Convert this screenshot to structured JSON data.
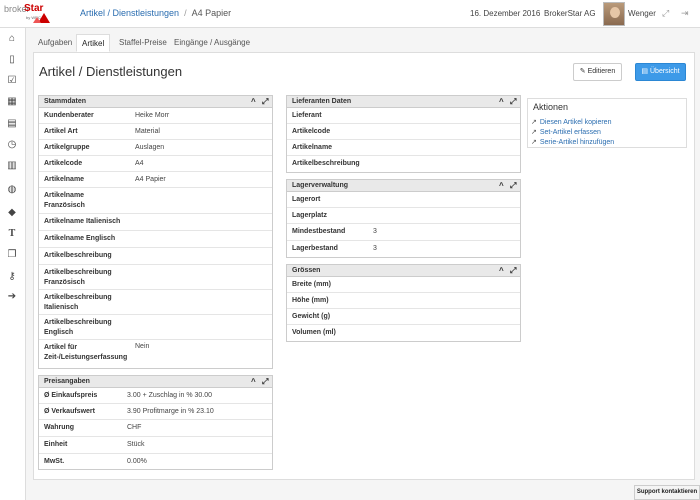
{
  "header": {
    "logo_text": "brokerStar",
    "logo_sub": "by WRC",
    "breadcrumb_parent": "Artikel / Dienstleistungen",
    "breadcrumb_sep": "/",
    "breadcrumb_current": "A4 Papier",
    "date": "16. Dezember 2016",
    "company": "BrokerStar AG",
    "username": "Wenger"
  },
  "sidebar": {
    "icons": [
      "home-icon",
      "document-icon",
      "checkbox-icon",
      "calendar-icon",
      "contract-icon",
      "clock-icon",
      "table-icon",
      "globe-icon",
      "tag-icon",
      "text-icon",
      "copy-icon",
      "key-icon",
      "arrow-circle-icon"
    ]
  },
  "tabs": [
    "Aufgaben",
    "Artikel",
    "Staffel-Preise",
    "Eingänge / Ausgänge"
  ],
  "page": {
    "title": "Artikel / Dienstleistungen",
    "edit_label": "Editieren",
    "overview_label": "Übersicht"
  },
  "stammdaten": {
    "title": "Stammdaten",
    "rows": [
      {
        "label": "Kundenberater",
        "value": "Heike Morr"
      },
      {
        "label": "Artikel Art",
        "value": "Material"
      },
      {
        "label": "Artikelgruppe",
        "value": "Auslagen"
      },
      {
        "label": "Artikelcode",
        "value": "A4"
      },
      {
        "label": "Artikelname",
        "value": "A4 Papier"
      },
      {
        "label": "Artikelname Französisch",
        "value": ""
      },
      {
        "label": "Artikelname Italienisch",
        "value": ""
      },
      {
        "label": "Artikelname Englisch",
        "value": ""
      },
      {
        "label": "Artikelbeschreibung",
        "value": ""
      },
      {
        "label": "Artikelbeschreibung Französisch",
        "value": ""
      },
      {
        "label": "Artikelbeschreibung Italienisch",
        "value": ""
      },
      {
        "label": "Artikelbeschreibung Englisch",
        "value": ""
      },
      {
        "label": "Artikel für Zeit-/Leistungserfassung",
        "value": "Nein"
      }
    ]
  },
  "preisangaben": {
    "title": "Preisangaben",
    "rows": [
      {
        "label": "Ø Einkaufspreis",
        "value": "3.00 + Zuschlag in % 30.00"
      },
      {
        "label": "Ø Verkaufswert",
        "value": "3.90 Profitmarge in % 23.10"
      },
      {
        "label": "Wahrung",
        "value": "CHF"
      },
      {
        "label": "Einheit",
        "value": "Stück"
      },
      {
        "label": "MwSt.",
        "value": "0.00%"
      }
    ]
  },
  "lieferanten": {
    "title": "Lieferanten Daten",
    "rows": [
      {
        "label": "Lieferant",
        "value": ""
      },
      {
        "label": "Artikelcode",
        "value": ""
      },
      {
        "label": "Artikelname",
        "value": ""
      },
      {
        "label": "Artikelbeschreibung",
        "value": ""
      }
    ]
  },
  "lagerverwaltung": {
    "title": "Lagerverwaltung",
    "rows": [
      {
        "label": "Lagerort",
        "value": ""
      },
      {
        "label": "Lagerplatz",
        "value": ""
      },
      {
        "label": "Mindestbestand",
        "value": "3"
      },
      {
        "label": "Lagerbestand",
        "value": "3"
      }
    ]
  },
  "groessen": {
    "title": "Grössen",
    "rows": [
      {
        "label": "Breite (mm)",
        "value": ""
      },
      {
        "label": "Höhe (mm)",
        "value": ""
      },
      {
        "label": "Gewicht (g)",
        "value": ""
      },
      {
        "label": "Volumen (ml)",
        "value": ""
      }
    ]
  },
  "aktionen": {
    "title": "Aktionen",
    "links": [
      "Diesen Artikel kopieren",
      "Set-Artikel erfassen",
      "Serie-Artikel hinzufügen"
    ]
  },
  "support_label": "Support kontaktieren",
  "colors": {
    "accent": "#3d9ae8",
    "brand": "#cc0000",
    "link": "#2a6db0"
  }
}
